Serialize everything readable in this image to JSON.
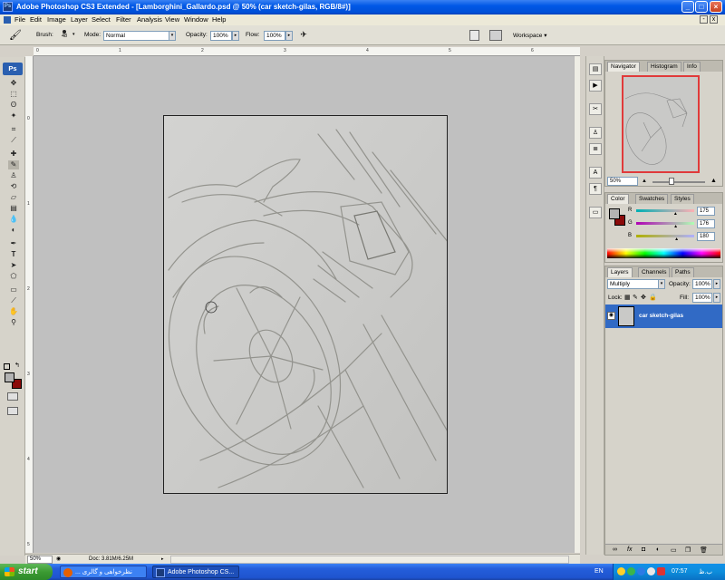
{
  "window": {
    "title": "Adobe Photoshop CS3 Extended - [Lamborghini_Gallardo.psd @ 50% (car sketch-gilas, RGB/8#)]",
    "buttons": [
      "_",
      "□",
      "×"
    ]
  },
  "menu": [
    "File",
    "Edit",
    "Image",
    "Layer",
    "Select",
    "Filter",
    "Analysis",
    "View",
    "Window",
    "Help"
  ],
  "options_bar": {
    "brush_label": "Brush:",
    "brush_size": "48",
    "mode_label": "Mode:",
    "mode_value": "Normal",
    "opacity_label": "Opacity:",
    "opacity_value": "100%",
    "flow_label": "Flow:",
    "flow_value": "100%",
    "workspace_label": "Workspace ▾"
  },
  "tools": {
    "badge": "Ps",
    "icons": [
      "move-tool",
      "marquee-tool",
      "lasso-tool",
      "magic-wand-tool",
      "crop-tool",
      "slice-tool",
      "healing-tool",
      "brush-tool",
      "clone-stamp-tool",
      "history-brush-tool",
      "eraser-tool",
      "gradient-tool",
      "blur-tool",
      "dodge-tool",
      "pen-tool",
      "type-tool",
      "path-selection-tool",
      "shape-tool",
      "notes-tool",
      "eyedropper-tool",
      "hand-tool",
      "zoom-tool"
    ],
    "foreground_color": "#b3b3b3",
    "background_color": "#8b0a0a"
  },
  "rulers": {
    "top": [
      "0",
      "1",
      "2",
      "3",
      "4",
      "5",
      "6"
    ],
    "left": [
      "0",
      "1",
      "2",
      "3",
      "4",
      "5"
    ]
  },
  "status_bar": {
    "zoom": "50%",
    "doc": "Doc: 3.81M/6.25M"
  },
  "navigator": {
    "tabs": [
      "Navigator",
      "Histogram",
      "Info"
    ],
    "zoom": "50%"
  },
  "color_panel": {
    "tabs": [
      "Color",
      "Swatches",
      "Styles"
    ],
    "channels": [
      {
        "label": "R",
        "value": "175",
        "level": 0.686
      },
      {
        "label": "G",
        "value": "176",
        "level": 0.69
      },
      {
        "label": "B",
        "value": "180",
        "level": 0.706
      }
    ]
  },
  "layers_panel": {
    "tabs": [
      "Layers",
      "Channels",
      "Paths"
    ],
    "blend_mode": "Multiply",
    "opacity_label": "Opacity:",
    "opacity_value": "100%",
    "lock_label": "Lock:",
    "fill_label": "Fill:",
    "fill_value": "100%",
    "layer_name": "car sketch-gilas",
    "footer_icons": [
      "link-icon",
      "fx-icon",
      "mask-icon",
      "adjustment-icon",
      "group-icon",
      "new-layer-icon",
      "trash-icon"
    ]
  },
  "taskbar": {
    "start_label": "start",
    "items": [
      {
        "label": "... نظرخواهی و گالری"
      },
      {
        "label": "Adobe Photoshop CS..."
      }
    ],
    "tray": {
      "language": "EN",
      "time": "07:57",
      "ampm": "ب.ظ"
    }
  },
  "colors": {
    "title_bar": "#0058e6",
    "selected_layer": "#316ac5",
    "navigator_box": "#e03a3a"
  }
}
